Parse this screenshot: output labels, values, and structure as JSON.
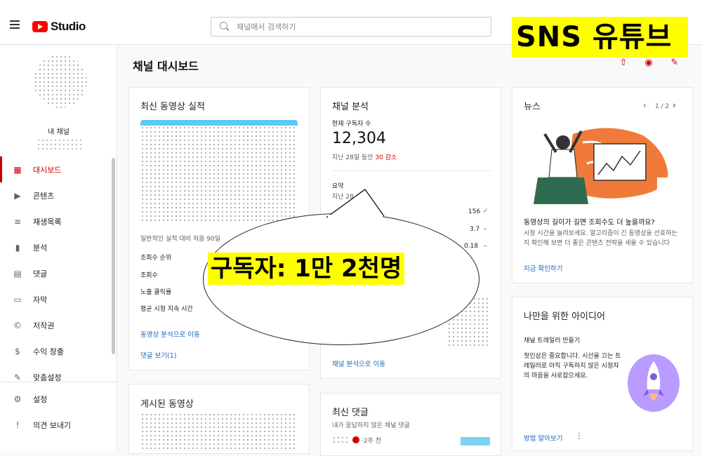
{
  "header": {
    "logo_text": "Studio",
    "search_placeholder": "채널에서 검색하기"
  },
  "overlay": {
    "banner_text": "SNS 유튜브",
    "bubble_text": "구독자: 1만 2천명"
  },
  "sidebar": {
    "channel_name": "내 채널",
    "items": [
      {
        "label": "대시보드",
        "icon": "dashboard-icon",
        "active": true
      },
      {
        "label": "콘텐츠",
        "icon": "content-icon"
      },
      {
        "label": "재생목록",
        "icon": "playlist-icon"
      },
      {
        "label": "분석",
        "icon": "analytics-icon"
      },
      {
        "label": "댓글",
        "icon": "comments-icon"
      },
      {
        "label": "자막",
        "icon": "subtitles-icon"
      },
      {
        "label": "저작권",
        "icon": "copyright-icon"
      },
      {
        "label": "수익 창출",
        "icon": "monetization-icon"
      },
      {
        "label": "맞춤설정",
        "icon": "customize-icon"
      }
    ],
    "bottom": [
      {
        "label": "설정",
        "icon": "settings-icon"
      },
      {
        "label": "의견 보내기",
        "icon": "feedback-icon"
      }
    ]
  },
  "page": {
    "title": "채널 대시보드"
  },
  "latest_video": {
    "title": "최신 동영상 실적",
    "note": "일반적인 실적 대비 처음 90일",
    "metrics": [
      "조회수 순위",
      "조회수",
      "노출 클릭률",
      "평균 시청 지속 시간"
    ],
    "link_analytics": "동영상 분석으로 이동",
    "link_comments": "댓글 보기(1)"
  },
  "published": {
    "title": "게시된 동영상"
  },
  "analytics": {
    "title": "채널 분석",
    "subs_label": "현재 구독자 수",
    "subs_value": "12,304",
    "change_prefix": "지난 28일 동안",
    "change_value": "30 감소",
    "summary_title": "요약",
    "summary_sub": "지난 28",
    "values": [
      "156",
      "3.7",
      "0.18"
    ],
    "link": "채널 분석으로 이동"
  },
  "comments_card": {
    "title": "최신 댓글",
    "sub": "내가 응답하지 않은 채널 댓글",
    "time": "·2주 전"
  },
  "news": {
    "title": "뉴스",
    "pager": "1 / 2",
    "headline": "동영상의 길이가 길면 조회수도 더 높을까요?",
    "body": "시청 시간을 늘려보세요. 알고리즘이 긴 동영상을 선호하는지 확인해 보면 더 좋은 콘텐츠 전략을 세울 수 있습니다",
    "link": "지금 확인하기"
  },
  "ideas": {
    "title": "나만을 위한 아이디어",
    "sub": "채널 트레일러 만들기",
    "body": "첫인상은 중요합니다. 시선을 끄는 트레일러로 아직 구독하지 않은 시청자의 마음을 사로잡으세요.",
    "link": "방법 알아보기"
  },
  "colors": {
    "brand_red": "#ff0000",
    "active_red": "#cc0000",
    "link_blue": "#1565c0",
    "highlight_yellow": "#ffff00",
    "decrease_red": "#cc0000"
  }
}
